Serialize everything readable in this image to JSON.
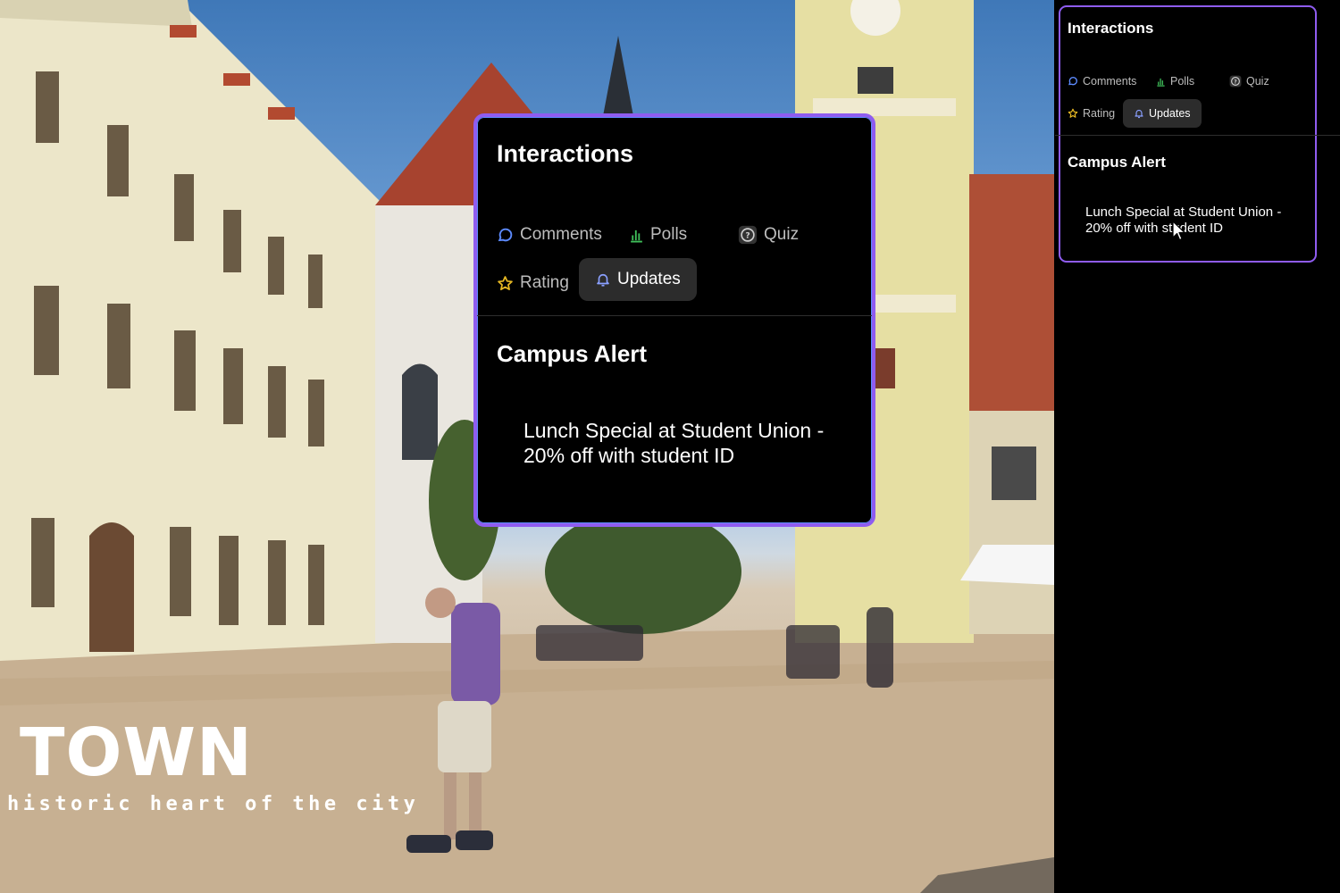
{
  "video": {
    "caption_title": "TOWN",
    "caption_subtitle": "historic heart of the city"
  },
  "card_main": {
    "title": "Interactions",
    "tabs": [
      {
        "label": "Comments",
        "icon": "comment-icon",
        "active": false
      },
      {
        "label": "Polls",
        "icon": "bar-chart-icon",
        "active": false
      },
      {
        "label": "Quiz",
        "icon": "question-icon",
        "active": false
      },
      {
        "label": "Rating",
        "icon": "star-icon",
        "active": false
      },
      {
        "label": "Updates",
        "icon": "bell-icon",
        "active": true
      }
    ],
    "alert_title": "Campus Alert",
    "alert_message": "Lunch Special at Student Union - 20% off with student ID"
  },
  "card_side": {
    "title": "Interactions",
    "tabs": [
      {
        "label": "Comments",
        "icon": "comment-icon",
        "active": false
      },
      {
        "label": "Polls",
        "icon": "bar-chart-icon",
        "active": false
      },
      {
        "label": "Quiz",
        "icon": "question-icon",
        "active": false
      },
      {
        "label": "Rating",
        "icon": "star-icon",
        "active": false
      },
      {
        "label": "Updates",
        "icon": "bell-icon",
        "active": true
      }
    ],
    "alert_title": "Campus Alert",
    "alert_message": "Lunch Special at Student Union - 20% off with student ID"
  },
  "colors": {
    "panel_border": "#8f5cf0",
    "accent_blue": "#5d8bff",
    "polls_green": "#3fbf5a",
    "star_yellow": "#e8b923",
    "active_tab_bg": "#2c2c2c"
  }
}
